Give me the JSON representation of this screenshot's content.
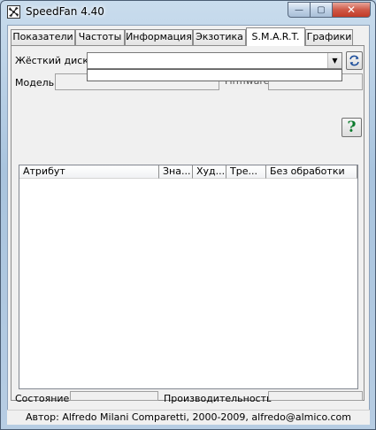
{
  "window": {
    "title": "SpeedFan 4.40",
    "minimize_glyph": "—",
    "maximize_glyph": "▢",
    "close_glyph": "✕"
  },
  "tabs": [
    {
      "label": "Показатели",
      "active": false
    },
    {
      "label": "Частоты",
      "active": false
    },
    {
      "label": "Информация",
      "active": false
    },
    {
      "label": "Экзотика",
      "active": false
    },
    {
      "label": "S.M.A.R.T.",
      "active": true
    },
    {
      "label": "Графики",
      "active": false
    }
  ],
  "smart": {
    "disk_label": "Жёсткий диск",
    "disk_value": "",
    "model_label": "Модель",
    "model_value": "",
    "firmware_label": "Firmware",
    "firmware_value": "",
    "help_glyph": "?",
    "table_columns": [
      "Атрибут",
      "Зна...",
      "Худ...",
      "Тре...",
      "Без обработки"
    ],
    "table_rows": [],
    "state_label": "Состояние",
    "state_value": "",
    "performance_label": "Производительность",
    "performance_value": ""
  },
  "status": {
    "text": "Автор: Alfredo Milani Comparetti, 2000-2009, alfredo@almico.com"
  },
  "colors": {
    "help_icon": "#0b7a2c",
    "refresh_icon": "#1e4f9c",
    "close_button": "#c23b27"
  }
}
